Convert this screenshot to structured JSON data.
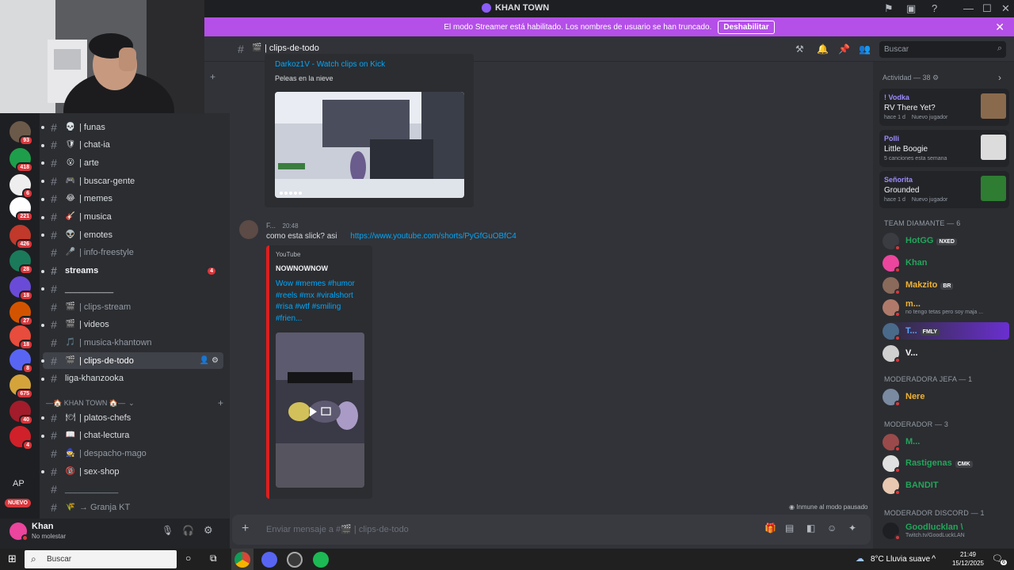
{
  "window": {
    "title": "KHAN TOWN"
  },
  "banner": {
    "text": "El modo Streamer está habilitado. Los nombres de usuario se han truncado.",
    "button": "Deshabilitar"
  },
  "server_rail": {
    "badges": [
      "93",
      "418",
      "6",
      "221",
      "426",
      "28",
      "18",
      "27",
      "18",
      "8",
      "675",
      "40",
      "4"
    ],
    "ap_label": "AP",
    "new_label": "NUEVO"
  },
  "channels": [
    {
      "emoji": "💀",
      "label": "| funas",
      "style": "normal"
    },
    {
      "emoji": "🛡",
      "label": "| chat-ia",
      "style": "normal"
    },
    {
      "emoji": "😮",
      "label": "| arte",
      "style": "normal"
    },
    {
      "emoji": "🎮",
      "label": "| buscar-gente",
      "style": "normal"
    },
    {
      "emoji": "😂",
      "label": "| memes",
      "style": "normal"
    },
    {
      "emoji": "🎸",
      "label": "| musica",
      "style": "normal"
    },
    {
      "emoji": "👽",
      "label": "| emotes",
      "style": "normal"
    },
    {
      "emoji": "🎤",
      "label": "| info-freestyle",
      "style": "dim"
    },
    {
      "emoji": "",
      "label": "streams",
      "style": "bold",
      "badge": "4"
    },
    {
      "emoji": "",
      "label": "__________",
      "style": "normal"
    },
    {
      "emoji": "🎬",
      "label": "| clips-stream",
      "style": "dim"
    },
    {
      "emoji": "🎬",
      "label": "| videos",
      "style": "normal"
    },
    {
      "emoji": "🎵",
      "label": "| musica-khantown",
      "style": "dim"
    },
    {
      "emoji": "🎬",
      "label": "| clips-de-todo",
      "style": "selected"
    },
    {
      "emoji": "",
      "label": "liga-khanzooka",
      "style": "normal"
    }
  ],
  "category": {
    "label": "—🏠 KHAN TOWN 🏠—"
  },
  "channels2": [
    {
      "emoji": "🍽",
      "label": "| platos-chefs",
      "style": "normal"
    },
    {
      "emoji": "📖",
      "label": "| chat-lectura",
      "style": "normal"
    },
    {
      "emoji": "🧙",
      "label": "| despacho-mago",
      "style": "dim"
    },
    {
      "emoji": "🔞",
      "label": "| sex-shop",
      "style": "normal"
    },
    {
      "emoji": "",
      "label": "___________",
      "style": "dim"
    },
    {
      "emoji": "🌾",
      "label": "→ Granja KT",
      "style": "dim"
    }
  ],
  "user": {
    "name": "Khan",
    "status": "No molestar"
  },
  "header": {
    "channel": "clips-de-todo",
    "search_placeholder": "Buscar"
  },
  "chat": {
    "embed1": {
      "link": "Darkoz1V - Watch clips on Kick",
      "desc": "Peleas en la nieve"
    },
    "message": {
      "author": "F...",
      "time": "20:48",
      "text": "como esta slick? asi",
      "url": "https://www.youtube.com/shorts/PyGfGuOBfC4"
    },
    "embed2": {
      "provider": "YouTube",
      "title": "NOWNOWNOW",
      "desc": "Wow #memes #humor #reels #mx #viralshort #risa #wtf #smiling #frien..."
    },
    "paused": "Inmune al modo pausado",
    "composer_placeholder": "Enviar mensaje a #🎬 | clips-de-todo"
  },
  "members": {
    "activity_title": "Actividad — 38",
    "activities": [
      {
        "user": "! Vodka",
        "game": "RV There Yet?",
        "meta1": "hace 1 d",
        "meta2": "Nuevo jugador"
      },
      {
        "user": "Polli",
        "game": "Little Boogie",
        "meta1": "5 canciones esta semana",
        "meta2": ""
      },
      {
        "user": "Señorita",
        "game": "Grounded",
        "meta1": "hace 1 d",
        "meta2": "Nuevo jugador"
      }
    ],
    "roles": [
      {
        "title": "TEAM DIAMANTE — 6"
      },
      {
        "title": "MODERADORA JEFA — 1"
      },
      {
        "title": "MODERADOR — 3"
      },
      {
        "title": "MODERADOR DISCORD — 1"
      }
    ],
    "people": [
      {
        "name": "HotGG",
        "tag": "NXED",
        "color": "#23a55a"
      },
      {
        "name": "Khan",
        "tag": "",
        "color": "#23a55a"
      },
      {
        "name": "Makzito",
        "tag": "BR",
        "color": "#f0b232"
      },
      {
        "name": "m...",
        "tag": "",
        "color": "#f0b232",
        "sub": "no tengo tetas pero soy maja ..."
      },
      {
        "name": "T...",
        "tag": "FMLY",
        "color": "#5aa7ff"
      },
      {
        "name": "V...",
        "tag": "",
        "color": "#ffffff"
      },
      {
        "name": "Nere",
        "tag": "",
        "color": "#f0b232"
      },
      {
        "name": "M...",
        "tag": "",
        "color": "#23a55a"
      },
      {
        "name": "Rastigenas",
        "tag": "CMK",
        "color": "#23a55a"
      },
      {
        "name": "BANDIT",
        "tag": "",
        "color": "#23a55a"
      },
      {
        "name": "Goodlucklan \\",
        "tag": "",
        "color": "#23a55a",
        "sub": "Twitch.tv/GoodLuckLAN"
      }
    ]
  },
  "taskbar": {
    "search": "Buscar",
    "weather": "8°C  Lluvia suave",
    "time": "21:49",
    "date": "15/12/2025",
    "notif": "6"
  }
}
